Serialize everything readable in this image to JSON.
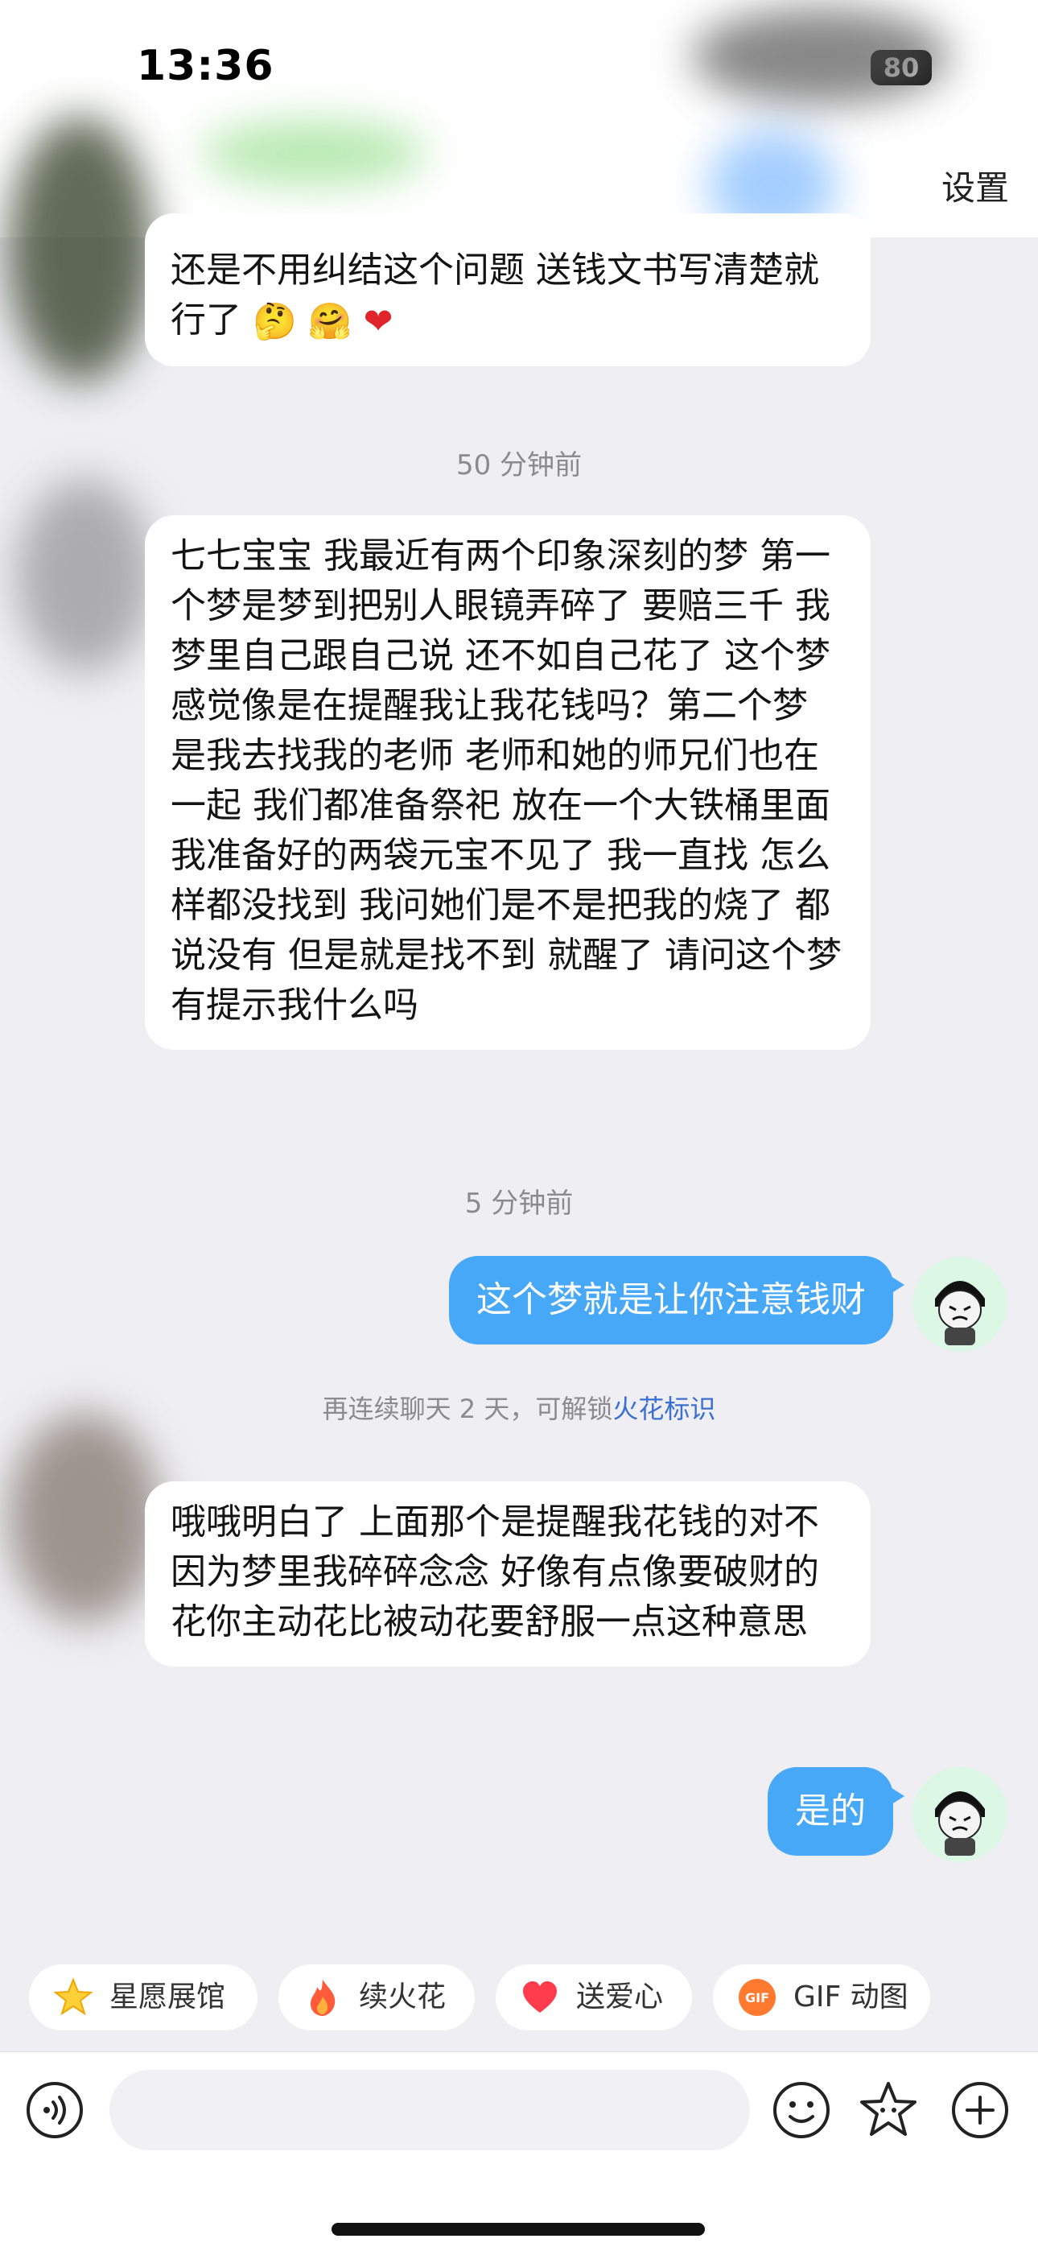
{
  "status_bar": {
    "time": "13:36",
    "battery": "80"
  },
  "header": {
    "settings_label": "设置"
  },
  "messages": {
    "msg1": {
      "text": "还是不用纠结这个问题 送钱文书写清楚就行了"
    },
    "ts1": "50 分钟前",
    "msg2": {
      "text": "七七宝宝 我最近有两个印象深刻的梦 第一个梦是梦到把别人眼镜弄碎了 要赔三千 我梦里自己跟自己说 还不如自己花了 这个梦感觉像是在提醒我让我花钱吗？第二个梦 是我去找我的老师 老师和她的师兄们也在一起 我们都准备祭祀 放在一个大铁桶里面 我准备好的两袋元宝不见了 我一直找 怎么样都没找到 我问她们是不是把我的烧了  都说没有 但是就是找不到 就醒了 请问这个梦有提示我什么吗"
    },
    "ts2": "5 分钟前",
    "msg3": {
      "text": "这个梦就是让你注意钱财"
    },
    "hint": {
      "prefix": "再连续聊天 2 天，可解锁",
      "link": "火花标识"
    },
    "msg4": {
      "text": "哦哦明白了 上面那个是提醒我花钱的对不 因为梦里我碎碎念念 好像有点像要破财的花你主动花比被动花要舒服一点这种意思"
    },
    "msg5": {
      "text": "是的"
    }
  },
  "chips": [
    {
      "label": "星愿展馆",
      "icon": "star-icon"
    },
    {
      "label": "续火花",
      "icon": "fire-icon"
    },
    {
      "label": "送爱心",
      "icon": "heart-icon"
    },
    {
      "label": "GIF 动图",
      "icon": "gif-icon"
    }
  ],
  "input": {
    "placeholder": ""
  },
  "colors": {
    "outgoing_bubble": "#48a8f8",
    "incoming_bubble": "#ffffff",
    "background": "#efeff3",
    "link": "#3b6fd0"
  }
}
